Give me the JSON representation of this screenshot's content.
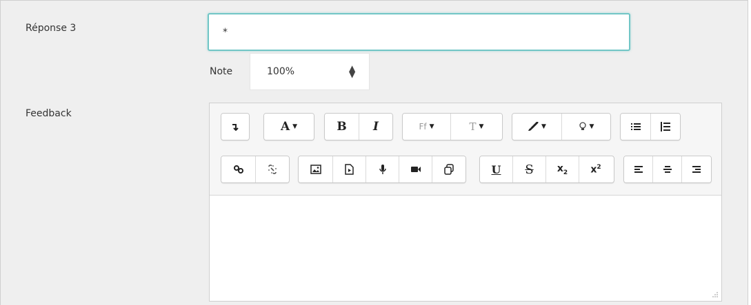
{
  "form": {
    "answer_label": "Réponse 3",
    "answer_value": "*",
    "grade_label": "Note",
    "grade_value": "100%",
    "feedback_label": "Feedback"
  },
  "colors": {
    "panel_bg": "#efefef",
    "focus_border": "#71c6c6"
  },
  "editor": {
    "toolbar_row1": [
      [
        "collapse-toggle"
      ],
      [
        "font-color"
      ],
      [
        "bold",
        "italic"
      ],
      [
        "font-family",
        "font-size"
      ],
      [
        "text-highlight",
        "styles"
      ],
      [
        "bullet-list",
        "numbered-list"
      ]
    ],
    "toolbar_row2": [
      [
        "link",
        "unlink"
      ],
      [
        "insert-image",
        "insert-media",
        "record-audio",
        "record-video",
        "manage-files"
      ],
      [
        "underline",
        "strikethrough",
        "subscript",
        "superscript"
      ],
      [
        "align-left",
        "align-center",
        "align-right"
      ]
    ],
    "glyphs": {
      "bold": "B",
      "italic": "I",
      "font_color": "A",
      "underline": "U",
      "strike": "S",
      "x": "x",
      "sub": "2",
      "sup": "2",
      "font_family": "Ff",
      "font_size": "T",
      "caret": "▼",
      "select_arrow": "⇕"
    }
  }
}
